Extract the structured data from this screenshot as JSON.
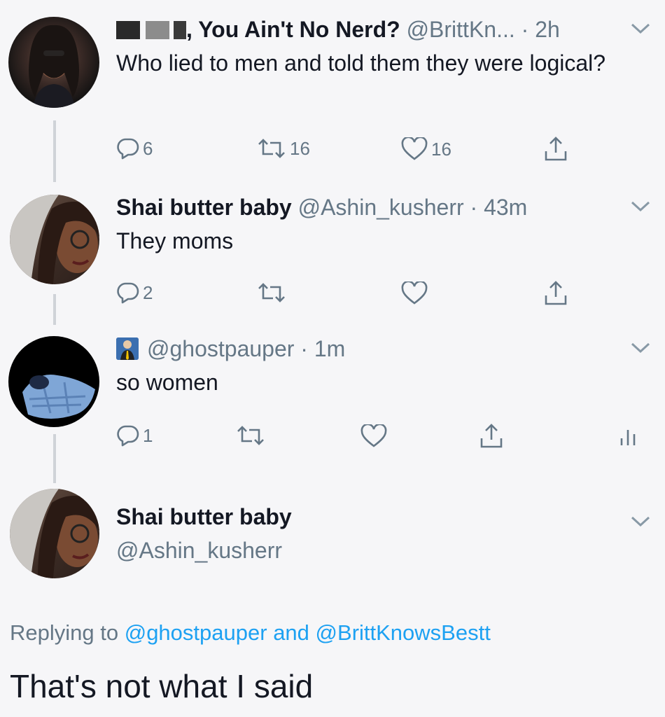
{
  "tweets": [
    {
      "display_name": ", You Ain't No Nerd?",
      "handle": "@BrittKn...",
      "time": "· 2h",
      "text": "Who lied to men and told them they were logical?",
      "replies": "6",
      "retweets": "16",
      "likes": "16"
    },
    {
      "display_name": "Shai butter baby",
      "handle": "@Ashin_kusherr",
      "time": "· 43m",
      "text": "They moms",
      "replies": "2",
      "retweets": "",
      "likes": ""
    },
    {
      "display_name": "",
      "handle": "@ghostpauper",
      "time": "· 1m",
      "text": "so women",
      "replies": "1",
      "retweets": "",
      "likes": ""
    }
  ],
  "focused": {
    "display_name": "Shai butter baby",
    "handle": "@Ashin_kusherr",
    "replying_prefix": "Replying to",
    "mention1": "@ghostpauper",
    "conjunction": "and",
    "mention2": "@BrittKnowsBestt",
    "text": "That's not what I said"
  },
  "colors": {
    "link": "#1da1f2",
    "secondary": "#657786",
    "primary": "#141823"
  },
  "icons": [
    "reply-icon",
    "retweet-icon",
    "like-icon",
    "share-icon",
    "analytics-icon",
    "chevron-down-icon"
  ]
}
